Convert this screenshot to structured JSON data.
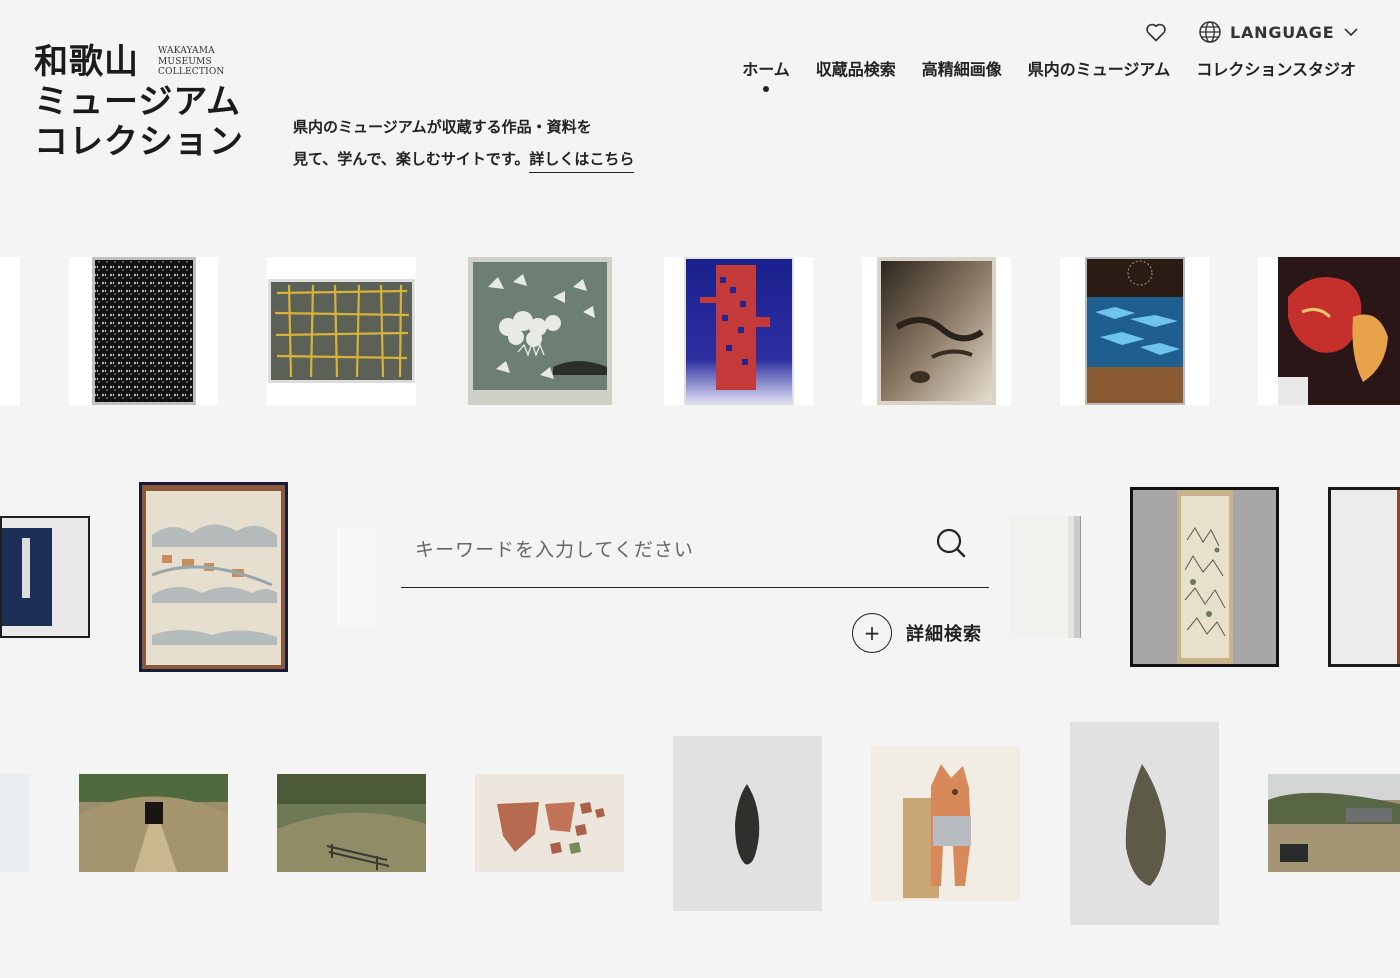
{
  "logo": {
    "jp_lines": [
      "和歌山",
      "ミュージアム",
      "コレクション"
    ],
    "en_lines": [
      "WAKAYAMA",
      "MUSEUMS",
      "COLLECTION"
    ]
  },
  "utility": {
    "favorites_icon": "heart-icon",
    "language_icon": "globe-icon",
    "language_label": "LANGUAGE",
    "language_chevron": "chevron-down-icon"
  },
  "nav": [
    {
      "label": "ホーム",
      "active": true
    },
    {
      "label": "収蔵品検索",
      "active": false
    },
    {
      "label": "高精細画像",
      "active": false
    },
    {
      "label": "県内のミュージアム",
      "active": false
    },
    {
      "label": "コレクションスタジオ",
      "active": false
    }
  ],
  "tagline": {
    "line1": "県内のミュージアムが収蔵する作品・資料を",
    "line2": "見て、学んで、楽しむサイトです。",
    "link": "詳しくはこちら"
  },
  "search": {
    "placeholder": "キーワードを入力してください",
    "icon": "search-icon",
    "advanced_label": "詳細検索",
    "advanced_icon": "plus-icon"
  }
}
